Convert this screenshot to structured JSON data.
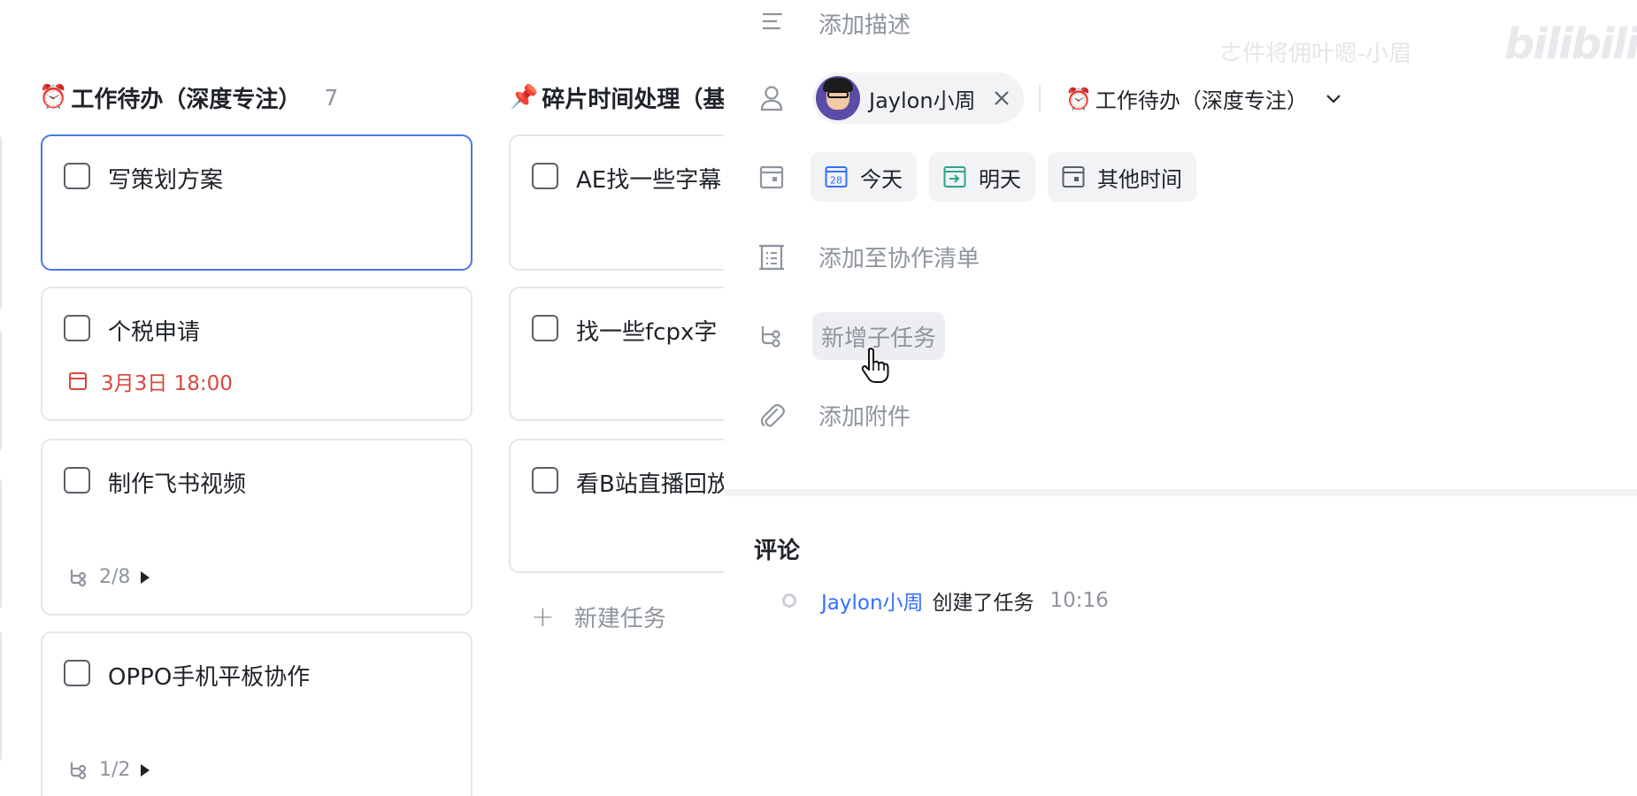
{
  "board": {
    "columns": [
      {
        "emoji": "⏰",
        "title": "工作待办（深度专注）",
        "count": "7"
      },
      {
        "emoji": "📌",
        "title": "碎片时间处理（基"
      }
    ],
    "col1_cards": [
      {
        "title": "写策划方案"
      },
      {
        "title": "个税申请",
        "due": "3月3日 18:00"
      },
      {
        "title": "制作飞书视频",
        "subtasks": "2/8"
      },
      {
        "title": "OPPO手机平板协作",
        "subtasks": "1/2"
      }
    ],
    "col2_cards": [
      {
        "title": "AE找一些字幕"
      },
      {
        "title": "找一些fcpx字"
      },
      {
        "title": "看B站直播回放"
      }
    ],
    "new_task_label": "新建任务"
  },
  "panel": {
    "description_placeholder": "添加描述",
    "assignee": {
      "name": "Jaylon小周"
    },
    "list": {
      "emoji": "⏰",
      "name": "工作待办（深度专注）"
    },
    "date_chips": [
      {
        "label": "今天",
        "icon": "calendar-today-icon",
        "day": "28",
        "color": "#3370ff"
      },
      {
        "label": "明天",
        "icon": "calendar-tomorrow-icon",
        "color": "#2ea58d"
      },
      {
        "label": "其他时间",
        "icon": "calendar-other-icon",
        "color": "#5b6068"
      }
    ],
    "add_to_list_label": "添加至协作清单",
    "add_subtask_label": "新增子任务",
    "add_attachment_label": "添加附件",
    "comments_title": "评论",
    "activity": {
      "user": "Jaylon小周",
      "action": "创建了任务",
      "time": "10:16"
    }
  },
  "watermark": {
    "text": "ㄜ件将佣叶嗯-小眉",
    "logo": "bilibili"
  },
  "colors": {
    "accent": "#3370ff",
    "selected_border": "#4a78e6",
    "danger": "#d9473f",
    "muted": "#8f959e"
  }
}
